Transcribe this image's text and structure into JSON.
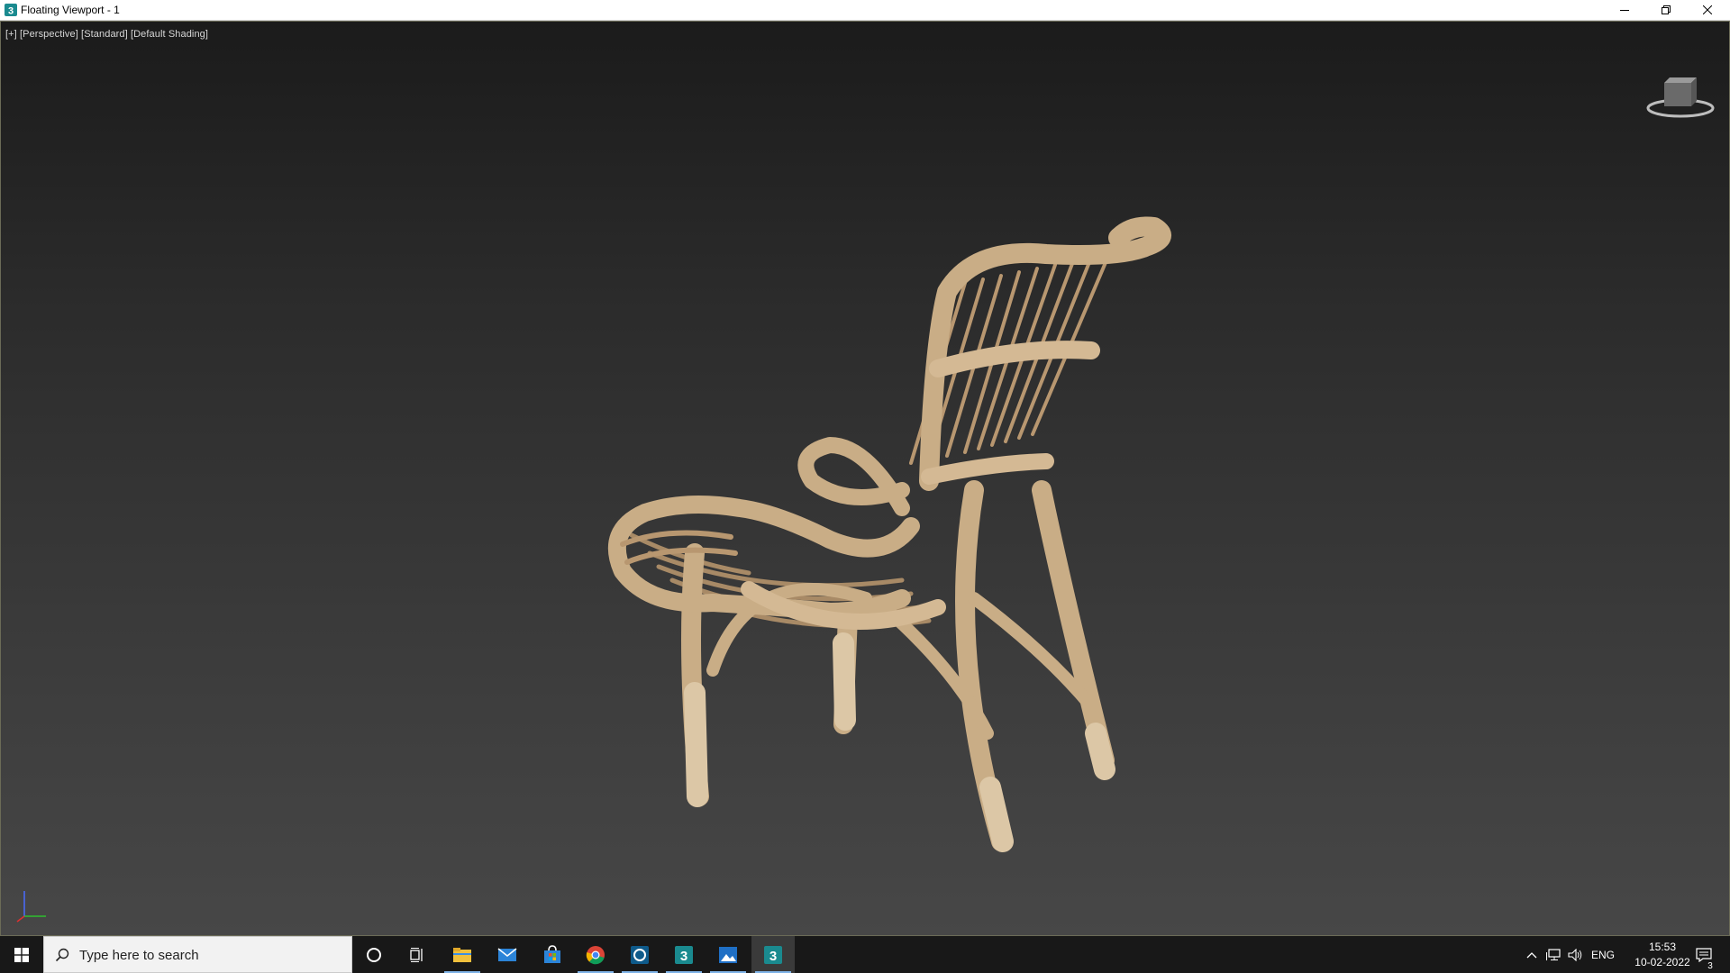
{
  "window": {
    "title": "Floating Viewport - 1",
    "icon": "3ds-max-icon"
  },
  "viewport": {
    "labels": [
      "[+]",
      "[Perspective]",
      "[Standard]",
      "[Default Shading]"
    ],
    "background_top": "#1b1b1b",
    "background_bottom": "#474747",
    "object_color": "#c9ad86"
  },
  "taskbar": {
    "search_placeholder": "Type here to search",
    "apps": [
      {
        "name": "cortana-icon"
      },
      {
        "name": "task-view-icon"
      },
      {
        "name": "file-explorer-icon"
      },
      {
        "name": "mail-icon"
      },
      {
        "name": "microsoft-store-icon"
      },
      {
        "name": "chrome-icon"
      },
      {
        "name": "sketchup-icon"
      },
      {
        "name": "3ds-max-icon"
      },
      {
        "name": "photos-icon"
      },
      {
        "name": "3ds-max-icon"
      }
    ],
    "tray": {
      "language": "ENG",
      "time": "15:53",
      "date": "10-02-2022",
      "notifications": "3"
    }
  }
}
